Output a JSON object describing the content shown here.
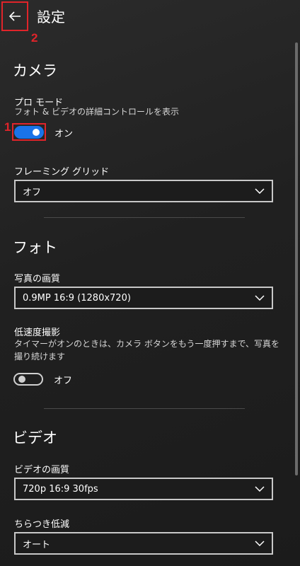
{
  "header": {
    "title": "設定"
  },
  "annotations": {
    "one": "1",
    "two": "2"
  },
  "camera": {
    "heading": "カメラ",
    "pro_mode": {
      "label": "プロ モード",
      "description": "フォト & ビデオの詳細コントロールを表示",
      "state": "オン",
      "on": true
    },
    "framing_grid": {
      "label": "フレーミング グリッド",
      "value": "オフ"
    }
  },
  "photo": {
    "heading": "フォト",
    "quality": {
      "label": "写真の画質",
      "value": "0.9MP 16:9 (1280x720)"
    },
    "time_lapse": {
      "label": "低速度撮影",
      "description": "タイマーがオンのときは、カメラ ボタンをもう一度押すまで、写真を撮り続けます",
      "state": "オフ",
      "on": false
    }
  },
  "video": {
    "heading": "ビデオ",
    "quality": {
      "label": "ビデオの画質",
      "value": "720p 16:9 30fps"
    },
    "flicker": {
      "label": "ちらつき低減",
      "value": "オート"
    }
  },
  "colors": {
    "accent": "#1a73e8",
    "callout": "#e0242a"
  },
  "icons": {
    "back": "back-arrow-icon",
    "dropdown": "chevron-down-icon"
  }
}
